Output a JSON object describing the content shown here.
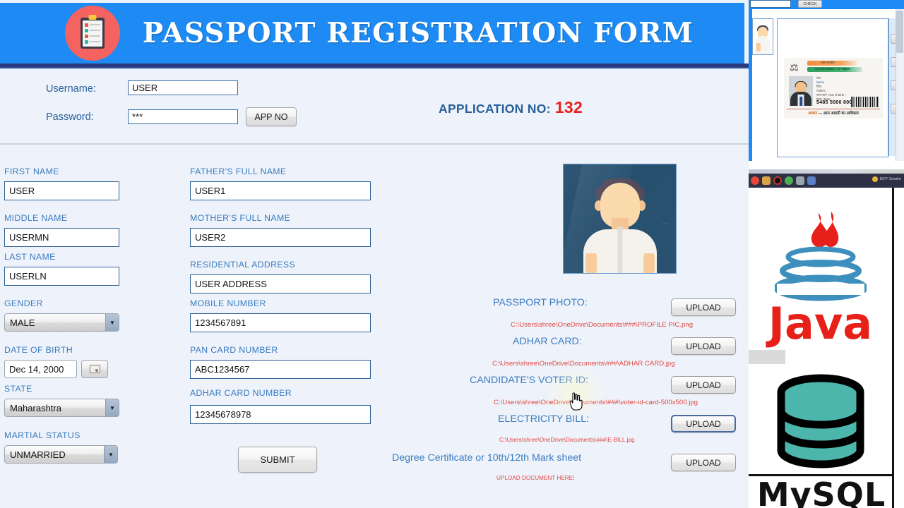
{
  "app": {
    "banner_title": "PASSPORT REGISTRATION FORM",
    "logo_icon": "clipboard-checklist-icon"
  },
  "login": {
    "username_label": "Username:",
    "username_value": "USER",
    "password_label": "Password:",
    "password_value": "***",
    "app_no_button": "APP NO",
    "application_no_label": "APPLICATION NO:",
    "application_no_value": "132"
  },
  "left_column": [
    {
      "label": "FIRST NAME",
      "value": "USER",
      "type": "text"
    },
    {
      "label": "MIDDLE NAME",
      "value": "USERMN",
      "type": "text"
    },
    {
      "label": "LAST NAME",
      "value": "USERLN",
      "type": "text"
    },
    {
      "label": "GENDER",
      "value": "MALE",
      "type": "combo"
    },
    {
      "label": "DATE OF BIRTH",
      "value": "Dec 14, 2000",
      "type": "date"
    },
    {
      "label": "STATE",
      "value": "Maharashtra",
      "type": "combo"
    },
    {
      "label": "MARTIAL STATUS",
      "value": "UNMARRIED",
      "type": "combo"
    }
  ],
  "middle_column": [
    {
      "label": "FATHER'S FULL NAME",
      "value": "USER1"
    },
    {
      "label": "MOTHER'S FULL NAME",
      "value": "USER2"
    },
    {
      "label": "RESIDENTIAL ADDRESS",
      "value": "USER ADDRESS"
    },
    {
      "label": "MOBILE NUMBER",
      "value": "1234567891"
    },
    {
      "label": "PAN CARD NUMBER",
      "value": "ABC1234567"
    },
    {
      "label": "ADHAR CARD NUMBER",
      "value": "12345678978"
    }
  ],
  "submit_label": "SUBMIT",
  "uploads": [
    {
      "label": "PASSPORT PHOTO:",
      "button": "UPLOAD",
      "path": "C:\\Users\\shree\\OneDrive\\Documents\\###\\PROFILE PIC.png"
    },
    {
      "label": "ADHAR CARD:",
      "button": "UPLOAD",
      "path": "C:\\Users\\shree\\OneDrive\\Documents\\###\\ADHAR CARD.jpg"
    },
    {
      "label": "CANDIDATE'S VOTER ID:",
      "button": "UPLOAD",
      "path": "C:\\Users\\shree\\OneDrive\\Documents\\###\\voter-id-card-500x500.jpg"
    },
    {
      "label": "ELECTRICITY BILL:",
      "button": "UPLOAD",
      "path": "C:\\Users\\shree\\OneDrive\\Documents\\###\\E-BILL.jpg"
    },
    {
      "label": "Degree Certificate or 10th/12th  Mark sheet",
      "button": "UPLOAD",
      "path": "UPLOAD DOCUMENT HERE!"
    }
  ],
  "photo": {
    "alt": "passport-photo-preview"
  },
  "sidebar": {
    "check_button": "CHECK",
    "aadhaar": {
      "gov_hindi": "भारत सरकार",
      "gov_english": "GOVERNMENT OF INDIA",
      "name_hindi": "नाम",
      "name_english": "Name",
      "father_hindi": "पिता",
      "father_english": "Father :",
      "dob_line": "जन्म वर्ष / Year of Birth :",
      "gender_line": "पुरुष / Male",
      "number": "5485 5000 8000",
      "footer_saffron": "आधार",
      "footer_text": "— आम आदमी का अधिकार"
    },
    "java_label": "Java",
    "mysql_label": "MySQL",
    "taskbar_clock": "83°F  Smoke"
  },
  "colors": {
    "banner_blue": "#1e8bf5",
    "accent_red": "#e8211c",
    "label_blue": "#3a7bbf",
    "path_red": "#e0473f",
    "java_red": "#e8201a",
    "mysql_teal": "#4db6ac"
  }
}
